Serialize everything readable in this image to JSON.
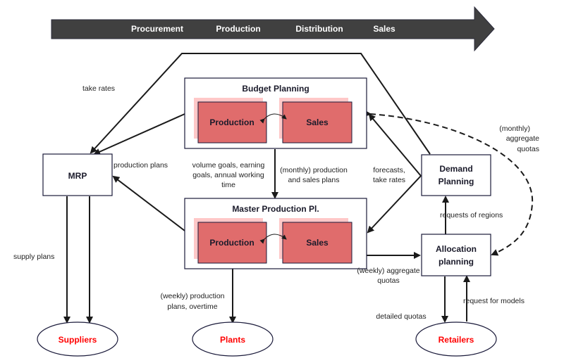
{
  "value_chain": {
    "stages": [
      "Procurement",
      "Production",
      "Distribution",
      "Sales"
    ]
  },
  "nodes": {
    "budget_planning": {
      "title": "Budget Planning",
      "left": "Production",
      "right": "Sales"
    },
    "master_production": {
      "title": "Master Production Pl.",
      "left": "Production",
      "right": "Sales"
    },
    "mrp": {
      "title": "MRP"
    },
    "demand_planning": {
      "title_line1": "Demand",
      "title_line2": "Planning"
    },
    "allocation_planning": {
      "title_line1": "Allocation",
      "title_line2": "planning"
    },
    "suppliers": {
      "title": "Suppliers"
    },
    "plants": {
      "title": "Plants"
    },
    "retailers": {
      "title": "Retailers"
    }
  },
  "edge_labels": {
    "take_rates": "take rates",
    "production_plans": "production plans",
    "volume_goals": [
      "volume goals, earning",
      "goals, annual working",
      "time"
    ],
    "monthly_plans": [
      "(monthly) production",
      "and sales plans"
    ],
    "forecasts": [
      "forecasts,",
      "take rates"
    ],
    "monthly_quotas": [
      "(monthly)",
      "aggregate",
      "quotas"
    ],
    "requests_regions": "requests of regions",
    "weekly_quotas": [
      "(weekly) aggregate",
      "quotas"
    ],
    "supply_plans": "supply plans",
    "weekly_production": [
      "(weekly) production",
      "plans, overtime"
    ],
    "detailed_quotas": "detailed quotas",
    "request_models": "request for models"
  },
  "colors": {
    "arrow_band": "#404040",
    "inner_box": "#e06c6c",
    "inner_shadow": "#ffc8c8",
    "box_border": "#1a1a3a",
    "entity_text": "#ff0000"
  }
}
